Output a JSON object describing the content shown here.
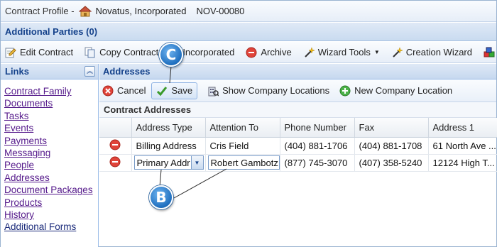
{
  "title_bar": {
    "prefix": "Contract Profile -",
    "company": "Novatus, Incorporated",
    "contract_number": "NOV-00080"
  },
  "parties_bar": {
    "label": "Additional Parties (0)"
  },
  "toolbar": {
    "edit_contract": "Edit Contract",
    "copy_contract": "Copy Contract",
    "add_incorporated": "dd Incorporated",
    "archive": "Archive",
    "wizard_tools": "Wizard Tools",
    "creation_wizard": "Creation Wizard"
  },
  "links": {
    "header": "Links",
    "items": [
      "Contract Family",
      "Documents",
      "Tasks",
      "Events",
      "Payments",
      "Messaging",
      "People",
      "Addresses",
      "Document Packages",
      "Products",
      "History",
      "Additional Forms"
    ]
  },
  "addresses": {
    "header": "Addresses",
    "cancel_label": "Cancel",
    "save_label": "Save",
    "show_locations_label": "Show Company Locations",
    "new_location_label": "New Company Location",
    "section_title": "Contract Addresses",
    "columns": [
      "Address Type",
      "Attention To",
      "Phone Number",
      "Fax",
      "Address 1"
    ],
    "rows": [
      {
        "address_type": "Billing Address",
        "attention_to": "Cris Field",
        "phone": "(404) 881-1706",
        "fax": "(404) 881-1708",
        "address1": "61 North Ave ..."
      },
      {
        "address_type": "Primary Addr",
        "attention_to": "Robert Gambotz",
        "phone": "(877) 745-3070",
        "fax": "(407) 358-5240",
        "address1": "12124 High T..."
      }
    ]
  },
  "callouts": {
    "c": "C",
    "b": "B"
  },
  "colors": {
    "header_text": "#15428b",
    "callout_blue": "#1f6fbf",
    "link_visited": "#551a8b"
  }
}
